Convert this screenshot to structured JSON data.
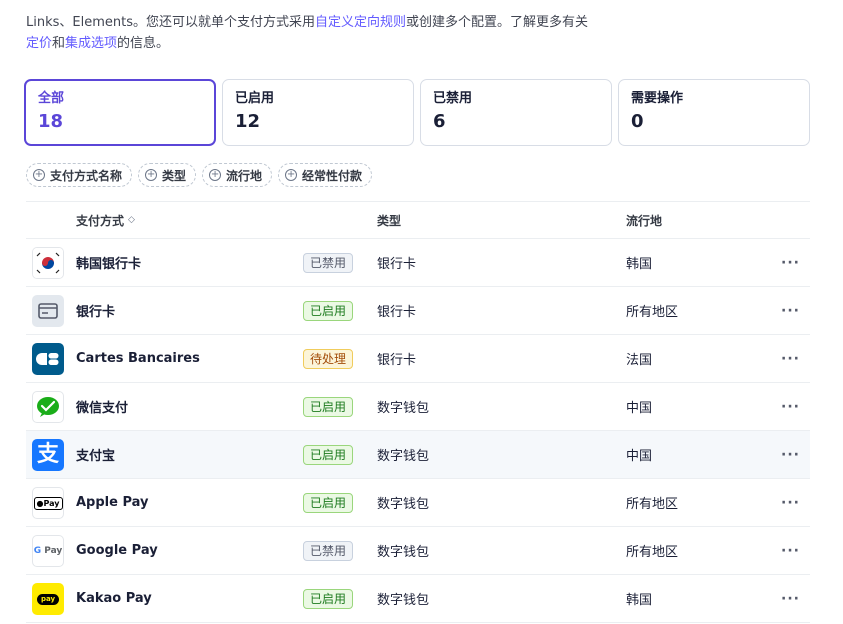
{
  "intro": {
    "line1_prefix": "Links、Elements。您还可以就单个支付方式采用",
    "line1_link": "自定义定向规则",
    "line1_suffix": "或创建多个配置。了解更多有关",
    "line2_link1": "定价",
    "line2_mid": "和",
    "line2_link2": "集成选项",
    "line2_suffix": "的信息。"
  },
  "cards": [
    {
      "label": "全部",
      "count": "18"
    },
    {
      "label": "已启用",
      "count": "12"
    },
    {
      "label": "已禁用",
      "count": "6"
    },
    {
      "label": "需要操作",
      "count": "0"
    }
  ],
  "filters": [
    "支付方式名称",
    "类型",
    "流行地",
    "经常性付款"
  ],
  "table": {
    "headers": {
      "name": "支付方式",
      "type": "类型",
      "region": "流行地"
    },
    "rows": [
      {
        "name": "韩国银行卡",
        "status": "已禁用",
        "type": "银行卡",
        "region": "韩国",
        "icon": "korea-flag-icon"
      },
      {
        "name": "银行卡",
        "status": "已启用",
        "type": "银行卡",
        "region": "所有地区",
        "icon": "card-icon"
      },
      {
        "name": "Cartes Bancaires",
        "status": "待处理",
        "type": "银行卡",
        "region": "法国",
        "icon": "cartes-bancaires-logo"
      },
      {
        "name": "微信支付",
        "status": "已启用",
        "type": "数字钱包",
        "region": "中国",
        "icon": "wechat-pay-logo"
      },
      {
        "name": "支付宝",
        "status": "已启用",
        "type": "数字钱包",
        "region": "中国",
        "icon": "alipay-logo"
      },
      {
        "name": "Apple Pay",
        "status": "已启用",
        "type": "数字钱包",
        "region": "所有地区",
        "icon": "apple-pay-logo"
      },
      {
        "name": "Google Pay",
        "status": "已禁用",
        "type": "数字钱包",
        "region": "所有地区",
        "icon": "google-pay-logo"
      },
      {
        "name": "Kakao Pay",
        "status": "已启用",
        "type": "数字钱包",
        "region": "韩国",
        "icon": "kakao-pay-logo"
      }
    ],
    "more_label": "···"
  },
  "colors": {
    "accent": "#5b46d8",
    "link": "#635bff",
    "enabled": "#1e7b1f",
    "pending": "#a34d0a",
    "disabled": "#545969"
  }
}
